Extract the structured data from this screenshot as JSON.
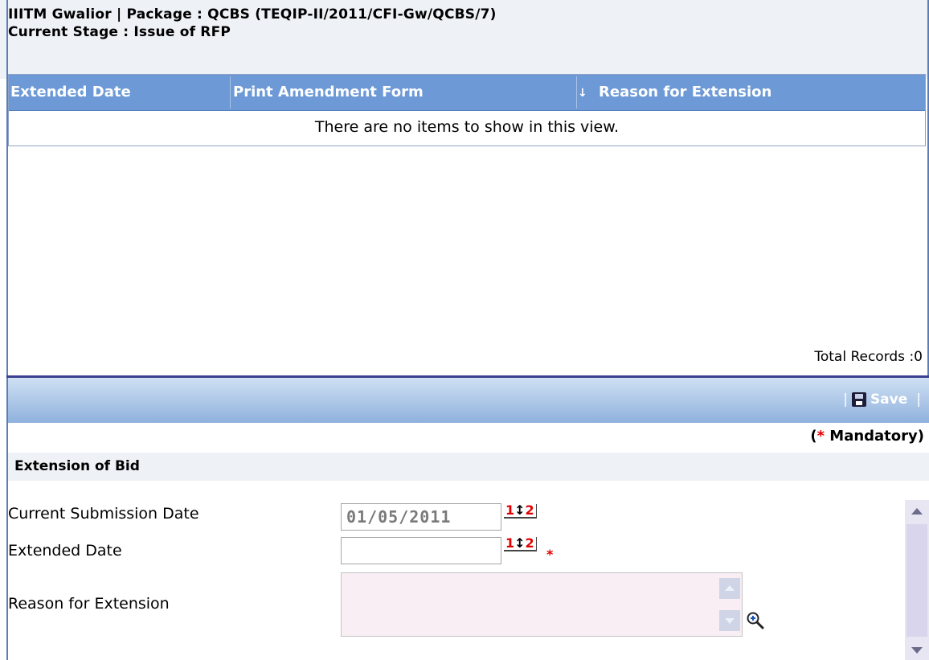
{
  "header": {
    "line1": "IIITM Gwalior | Package : QCBS (TEQIP-II/2011/CFI-Gw/QCBS/7)",
    "line2": "Current Stage : Issue of RFP"
  },
  "grid": {
    "columns": [
      "Extended Date",
      "Print Amendment Form",
      "Reason for Extension"
    ],
    "sort_indicator": "↓",
    "empty_message": "There are no items to show in this view.",
    "total_label": "Total Records :0"
  },
  "toolbar": {
    "save_label": "Save",
    "bar_left": "|",
    "bar_right": "|"
  },
  "mandatory": {
    "open": "(",
    "star": "*",
    "label": "Mandatory)"
  },
  "section": {
    "title": "Extension of Bid"
  },
  "form": {
    "current_submission_label": "Current Submission Date",
    "current_submission_value": "01/05/2011",
    "extended_date_label": "Extended Date",
    "extended_date_value": "",
    "reason_label": "Reason for Extension",
    "reason_value": "",
    "calendar_left": "1",
    "calendar_mid": "↕",
    "calendar_right": "2",
    "required_star": "*"
  },
  "icons": {
    "save": "floppy-disk-icon",
    "calendar": "calendar-picker-icon",
    "zoom": "magnifier-plus-icon"
  },
  "colors": {
    "grid_header": "#6d9ad6",
    "toolbar_top": "#cfe0f3",
    "toolbar_bottom": "#8fb1dd",
    "required": "#e00000",
    "separator": "#3b3f8f"
  }
}
